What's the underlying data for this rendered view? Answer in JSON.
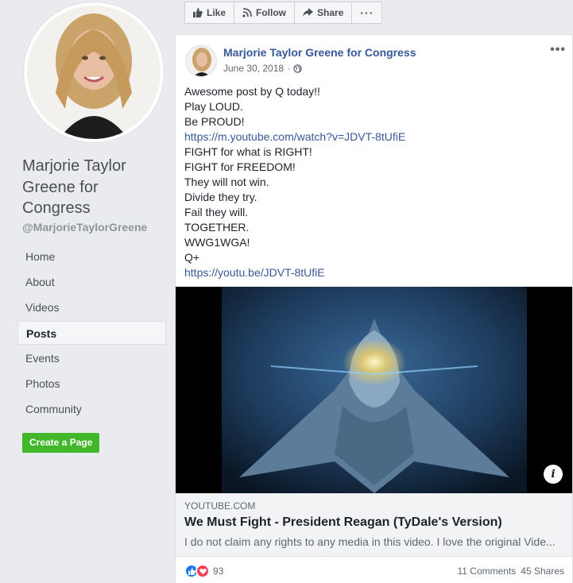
{
  "sidebar": {
    "page_name": "Marjorie Taylor Greene for Congress",
    "handle": "@MarjorieTaylorGreene",
    "nav": [
      "Home",
      "About",
      "Videos",
      "Posts",
      "Events",
      "Photos",
      "Community"
    ],
    "active_nav": "Posts",
    "create_page": "Create a Page"
  },
  "actions": {
    "like": "Like",
    "follow": "Follow",
    "share": "Share",
    "more": "···"
  },
  "post": {
    "author": "Marjorie Taylor Greene for Congress",
    "date": "June 30, 2018",
    "more": "•••",
    "lines": [
      {
        "text": "Awesome post by Q today!!",
        "link": false
      },
      {
        "text": "Play LOUD.",
        "link": false
      },
      {
        "text": "Be PROUD!",
        "link": false
      },
      {
        "text": "https://m.youtube.com/watch?v=JDVT-8tUfiE",
        "link": true
      },
      {
        "text": "FIGHT for what is RIGHT!",
        "link": false
      },
      {
        "text": "FIGHT for FREEDOM!",
        "link": false
      },
      {
        "text": "They will not win.",
        "link": false
      },
      {
        "text": "Divide they try.",
        "link": false
      },
      {
        "text": "Fail they will.",
        "link": false
      },
      {
        "text": "TOGETHER.",
        "link": false
      },
      {
        "text": "WWG1WGA!",
        "link": false
      },
      {
        "text": "Q+",
        "link": false
      },
      {
        "text": "https://youtu.be/JDVT-8tUfiE",
        "link": true
      }
    ],
    "link_preview": {
      "domain": "YOUTUBE.COM",
      "title": "We Must Fight - President Reagan (TyDale's Version)",
      "description": "I do not claim any rights to any media in this video. I love the original Vide..."
    },
    "reactions_count": "93",
    "comments": "11 Comments",
    "shares": "45 Shares"
  },
  "colors": {
    "link": "#385898",
    "author": "#365899",
    "create_button": "#42b72a"
  }
}
